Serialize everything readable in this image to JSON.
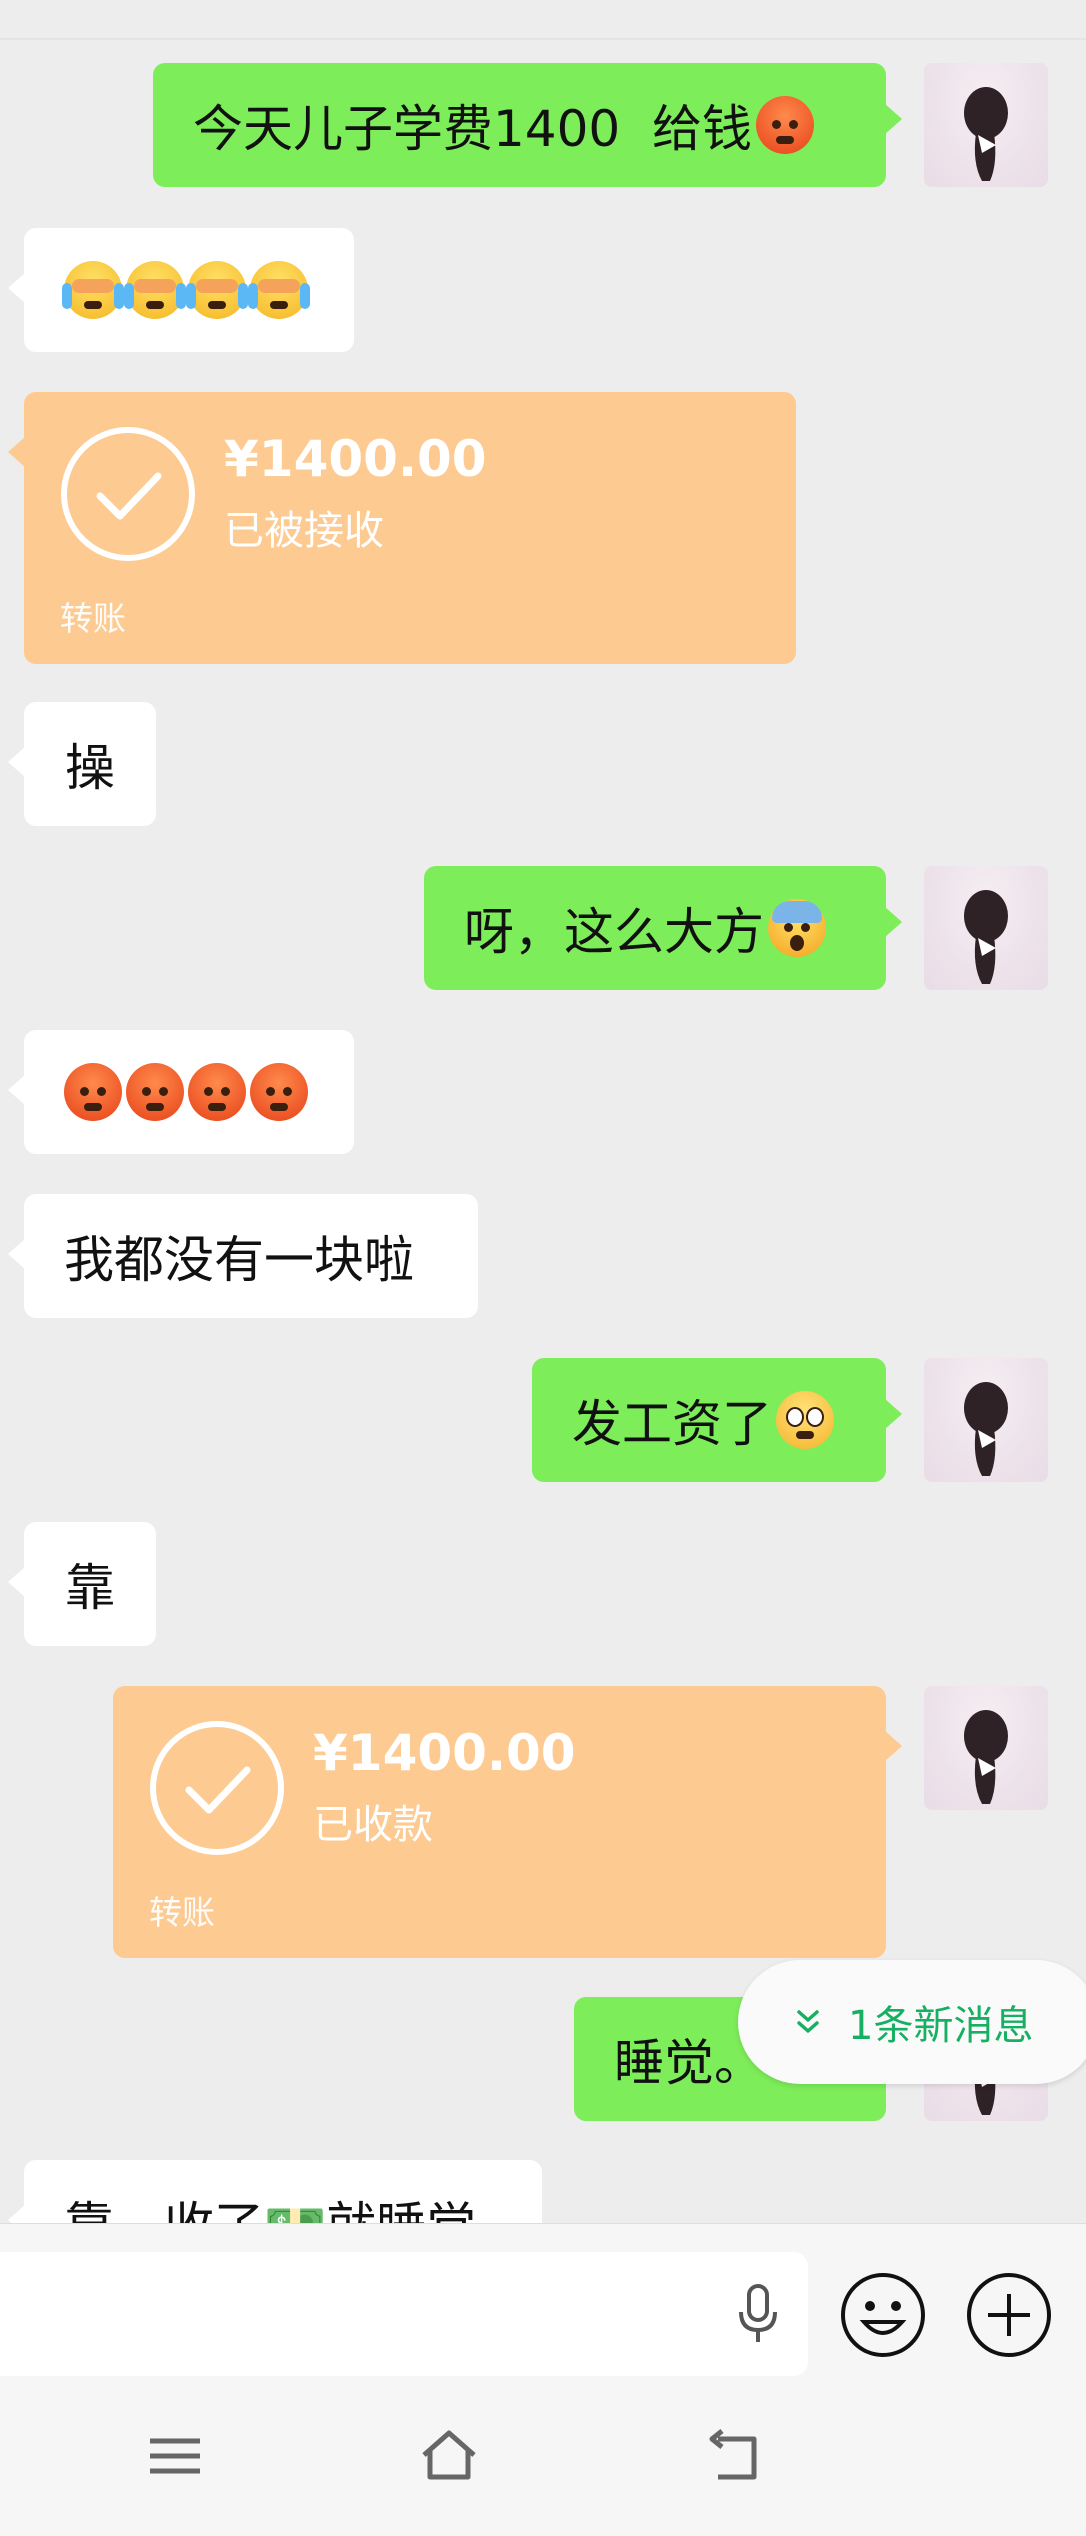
{
  "messages": [
    {
      "side": "right",
      "text": "今天儿子学费1400  给钱",
      "emoji": [
        "angry"
      ]
    },
    {
      "side": "left",
      "text": "",
      "emoji": [
        "cry",
        "cry",
        "cry",
        "cry"
      ]
    },
    {
      "side": "left",
      "type": "transfer",
      "amount": "¥1400.00",
      "status": "已被接收",
      "label": "转账"
    },
    {
      "side": "left",
      "text": "操"
    },
    {
      "side": "right",
      "text": "呀，这么大方",
      "emoji": [
        "scream"
      ]
    },
    {
      "side": "left",
      "text": "",
      "emoji": [
        "angry",
        "angry",
        "angry",
        "angry"
      ]
    },
    {
      "side": "left",
      "text": "我都没有一块啦"
    },
    {
      "side": "right",
      "text": "发工资了",
      "emoji": [
        "surprised"
      ]
    },
    {
      "side": "left",
      "text": "靠"
    },
    {
      "side": "right",
      "type": "transfer",
      "amount": "¥1400.00",
      "status": "已收款",
      "label": "转账"
    },
    {
      "side": "right",
      "text": "睡觉。"
    },
    {
      "side": "left",
      "text": "靠，收了💵就睡觉"
    }
  ],
  "new_message_pill": {
    "text": "1条新消息",
    "color": "#17b062"
  },
  "colors": {
    "right_bubble": "#7ded5a",
    "left_bubble": "#ffffff",
    "transfer": "#fdca92",
    "background": "#ededed"
  },
  "input": {
    "placeholder": ""
  },
  "icons": [
    "mic-icon",
    "emoji-icon",
    "plus-icon",
    "menu-icon",
    "home-icon",
    "back-icon"
  ]
}
